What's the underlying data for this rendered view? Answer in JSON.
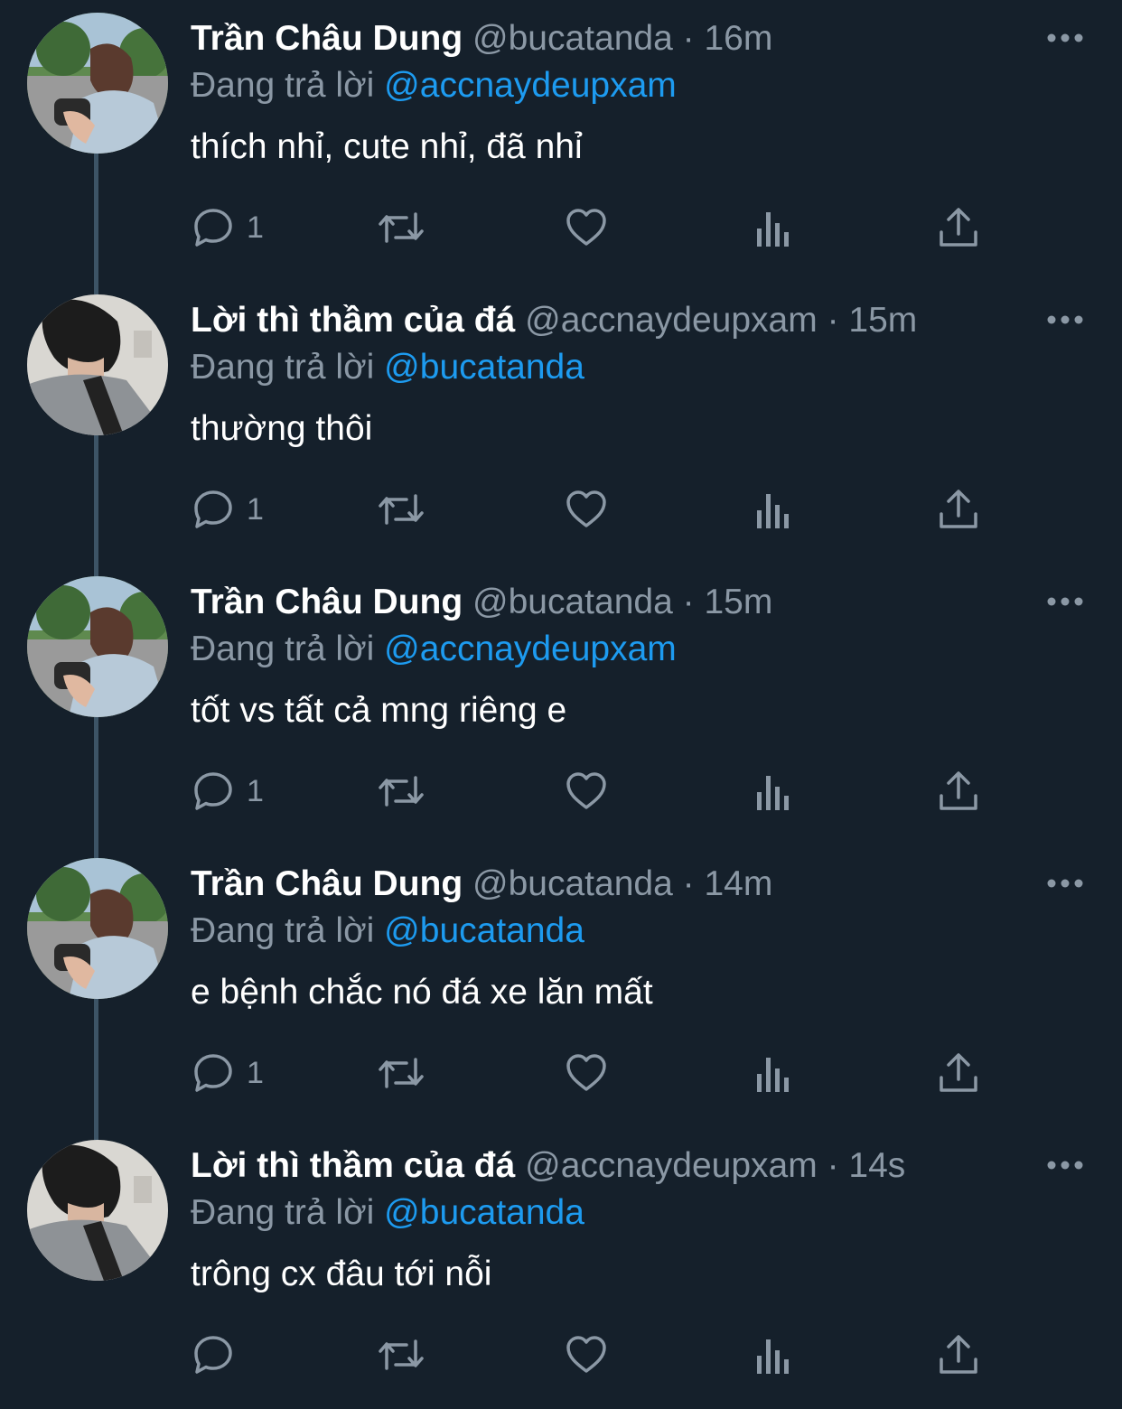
{
  "replying_label": "Đang trả lời",
  "separator": "·",
  "tweets": [
    {
      "display_name": "Trần Châu Dung",
      "handle": "@bucatanda",
      "time": "16m",
      "replying_to": "@accnaydeupxam",
      "text": "thích nhỉ, cute nhỉ, đã nhỉ",
      "reply_count": "1",
      "avatar": "user-bucatanda"
    },
    {
      "display_name": "Lời thì thầm của đá",
      "handle": "@accnaydeupxam",
      "time": "15m",
      "replying_to": "@bucatanda",
      "text": "thường thôi",
      "reply_count": "1",
      "avatar": "user-accnaydeupxam"
    },
    {
      "display_name": "Trần Châu Dung",
      "handle": "@bucatanda",
      "time": "15m",
      "replying_to": "@accnaydeupxam",
      "text": "tốt vs tất cả mng riêng e",
      "reply_count": "1",
      "avatar": "user-bucatanda"
    },
    {
      "display_name": "Trần Châu Dung",
      "handle": "@bucatanda",
      "time": "14m",
      "replying_to": "@bucatanda",
      "text": "e bệnh chắc nó đá xe lăn mất",
      "reply_count": "1",
      "avatar": "user-bucatanda"
    },
    {
      "display_name": "Lời thì thầm của đá",
      "handle": "@accnaydeupxam",
      "time": "14s",
      "replying_to": "@bucatanda",
      "text": "trông cx đâu tới nỗi",
      "reply_count": "",
      "avatar": "user-accnaydeupxam"
    }
  ],
  "icons": {
    "reply": "reply-icon",
    "retweet": "retweet-icon",
    "like": "heart-icon",
    "analytics": "analytics-icon",
    "share": "share-icon",
    "more": "more-icon"
  },
  "colors": {
    "background": "#15202b",
    "secondary_text": "#8b98a5",
    "link": "#1d9bf0",
    "thread_line": "#3d5466"
  }
}
